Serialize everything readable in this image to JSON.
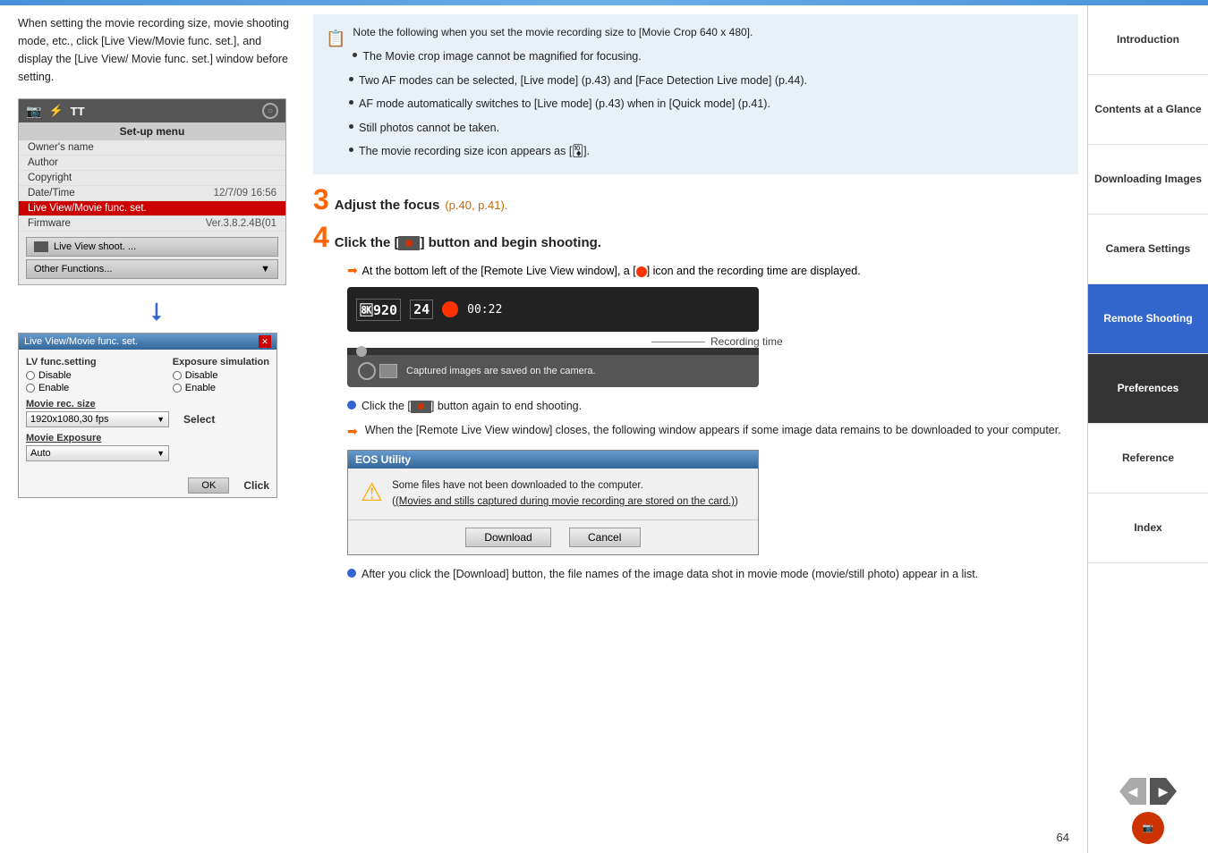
{
  "topbar": {
    "color": "#4a90d9"
  },
  "left": {
    "intro_text": "When setting the movie recording size, movie shooting mode, etc., click [Live View/Movie func. set.], and display the [Live View/ Movie func. set.] window before setting.",
    "menu_title": "Set-up menu",
    "menu_rows": [
      {
        "label": "Owner's name",
        "value": ""
      },
      {
        "label": "Author",
        "value": ""
      },
      {
        "label": "Copyright",
        "value": ""
      },
      {
        "label": "Date/Time",
        "value": "12/7/09  16:56"
      },
      {
        "label": "Live View/Movie func. set.",
        "value": "",
        "highlighted": true
      },
      {
        "label": "Firmware",
        "value": "Ver.3.8.2.4B(01"
      }
    ],
    "menu_btn1": "Live View shoot. ...",
    "menu_btn2": "Other Functions...",
    "dialog_title": "Live View/Movie func. set.",
    "dialog_col1_header": "LV func.setting",
    "dialog_col2_header": "Exposure simulation",
    "radio1_col1": [
      "Disable",
      "Enable"
    ],
    "radio1_col2": [
      "Disable",
      "Enable"
    ],
    "section_movie_rec": "Movie rec. size",
    "select_movie_rec": "1920x1080,30 fps",
    "section_movie_exp": "Movie Exposure",
    "select_movie_exp": "Auto",
    "ok_btn": "OK",
    "select_label": "Select",
    "click_label": "Click"
  },
  "right": {
    "note_text1": "Note the following when you set the movie recording size to [Movie Crop 640 x 480].",
    "note_bullets": [
      "The Movie crop image cannot be magnified for focusing.",
      "Two AF modes can be selected, [Live mode] (p.43) and [Face Detection Live mode] (p.44).",
      "AF mode automatically switches to [Live mode] (p.43) when in [Quick mode] (p.41).",
      "Still photos cannot be taken.",
      "The movie recording size icon appears as [🃊]."
    ],
    "step3_label": "3",
    "step3_text": "Adjust the focus",
    "step3_links": "(p.40, p.41).",
    "step4_label": "4",
    "step4_text": "Click the [",
    "step4_text2": "] button and begin shooting.",
    "step4_sub": "At the bottom left of the [Remote Live View window], a [",
    "step4_sub2": "] icon and the recording time are displayed.",
    "rec_res": "1920",
    "rec_fps": "24",
    "rec_time": "00:22",
    "rec_time_annotation": "Recording time",
    "captured_text": "Captured images are saved on the camera.",
    "bullet1_text": "Click the [",
    "bullet1_text2": "] button again to end shooting.",
    "bullet2_text": "When the [Remote Live View window] closes, the following window appears if some image data remains to be downloaded to your computer.",
    "eos_title": "EOS Utility",
    "eos_msg1": "Some files have not been downloaded to the computer.",
    "eos_msg2": "(Movies and stills captured during movie recording are stored on the card.)",
    "eos_download_btn": "Download",
    "eos_cancel_btn": "Cancel",
    "after_text": "After you click the [Download] button, the file names of the image data shot in movie mode (movie/still photo) appear in a list."
  },
  "sidebar": {
    "items": [
      {
        "label": "Introduction",
        "state": "normal"
      },
      {
        "label": "Contents at a Glance",
        "state": "normal"
      },
      {
        "label": "Downloading Images",
        "state": "normal"
      },
      {
        "label": "Camera Settings",
        "state": "normal"
      },
      {
        "label": "Remote Shooting",
        "state": "active-blue"
      },
      {
        "label": "Preferences",
        "state": "active-dark"
      },
      {
        "label": "Reference",
        "state": "normal"
      },
      {
        "label": "Index",
        "state": "normal"
      }
    ]
  },
  "page_number": "64"
}
